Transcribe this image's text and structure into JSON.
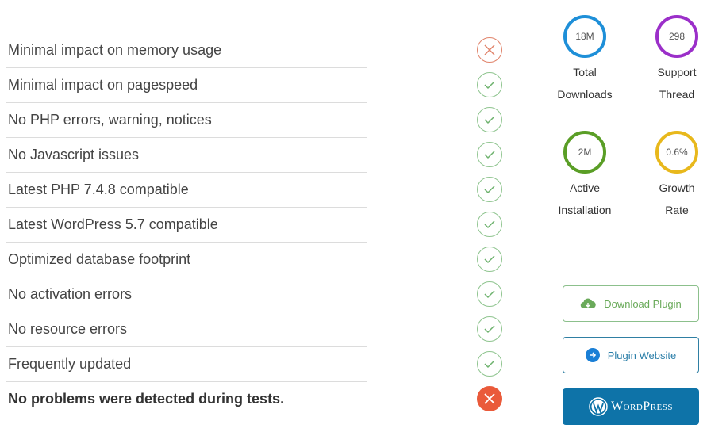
{
  "checklist": [
    {
      "label": "Minimal impact on memory usage",
      "status": "fail"
    },
    {
      "label": "Minimal impact on pagespeed",
      "status": "pass"
    },
    {
      "label": "No PHP errors, warning, notices",
      "status": "pass"
    },
    {
      "label": "No Javascript issues",
      "status": "pass"
    },
    {
      "label": "Latest PHP 7.4.8 compatible",
      "status": "pass"
    },
    {
      "label": "Latest WordPress 5.7 compatible",
      "status": "pass"
    },
    {
      "label": "Optimized database footprint",
      "status": "pass"
    },
    {
      "label": "No activation errors",
      "status": "pass"
    },
    {
      "label": "No resource errors",
      "status": "pass"
    },
    {
      "label": "Frequently updated",
      "status": "pass"
    },
    {
      "label": "No problems were detected during tests.",
      "status": "fail"
    }
  ],
  "stats": {
    "downloads": {
      "value": "18M",
      "line1": "Total",
      "line2": "Downloads",
      "color": "#1e8fd8"
    },
    "support": {
      "value": "298",
      "line1": "Support",
      "line2": "Thread",
      "color": "#9b2fc9"
    },
    "installs": {
      "value": "2M",
      "line1": "Active",
      "line2": "Installation",
      "color": "#5a9e26"
    },
    "growth": {
      "value": "0.6%",
      "line1": "Growth",
      "line2": "Rate",
      "color": "#e8b81c"
    }
  },
  "buttons": {
    "download": "Download Plugin",
    "website": "Plugin Website",
    "wordpress": "WordPress"
  }
}
